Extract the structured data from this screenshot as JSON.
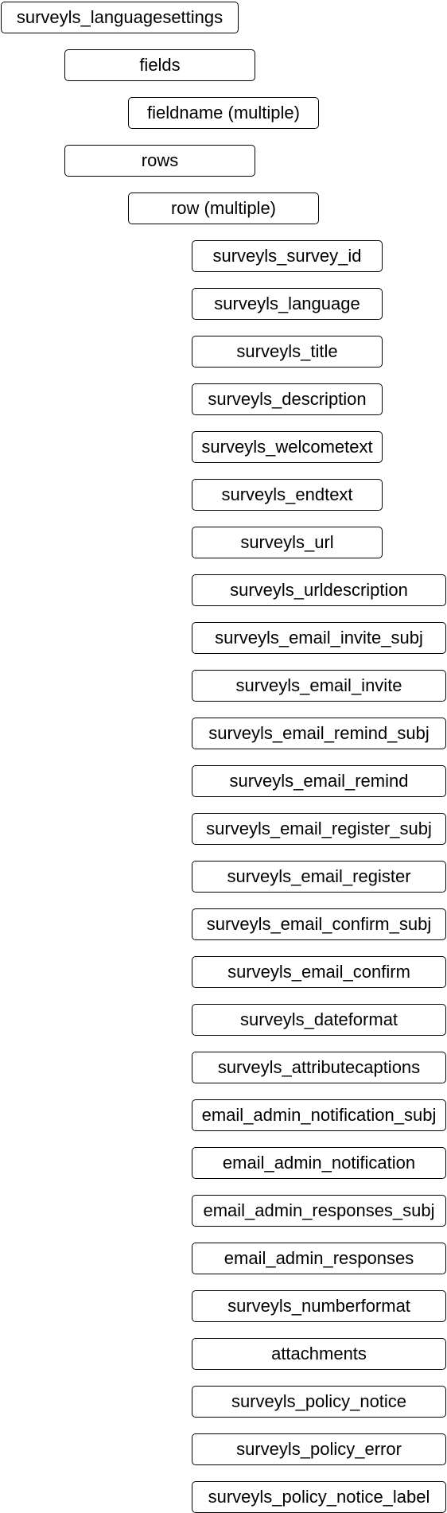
{
  "nodes": [
    "surveyls_languagesettings",
    "fields",
    "fieldname (multiple)",
    "rows",
    "row (multiple)",
    "surveyls_survey_id",
    "surveyls_language",
    "surveyls_title",
    "surveyls_description",
    "surveyls_welcometext",
    "surveyls_endtext",
    "surveyls_url",
    "surveyls_urldescription",
    "surveyls_email_invite_subj",
    "surveyls_email_invite",
    "surveyls_email_remind_subj",
    "surveyls_email_remind",
    "surveyls_email_register_subj",
    "surveyls_email_register",
    "surveyls_email_confirm_subj",
    "surveyls_email_confirm",
    "surveyls_dateformat",
    "surveyls_attributecaptions",
    "email_admin_notification_subj",
    "email_admin_notification",
    "email_admin_responses_subj",
    "email_admin_responses",
    "surveyls_numberformat",
    "attachments",
    "surveyls_policy_notice",
    "surveyls_policy_error",
    "surveyls_policy_notice_label"
  ]
}
